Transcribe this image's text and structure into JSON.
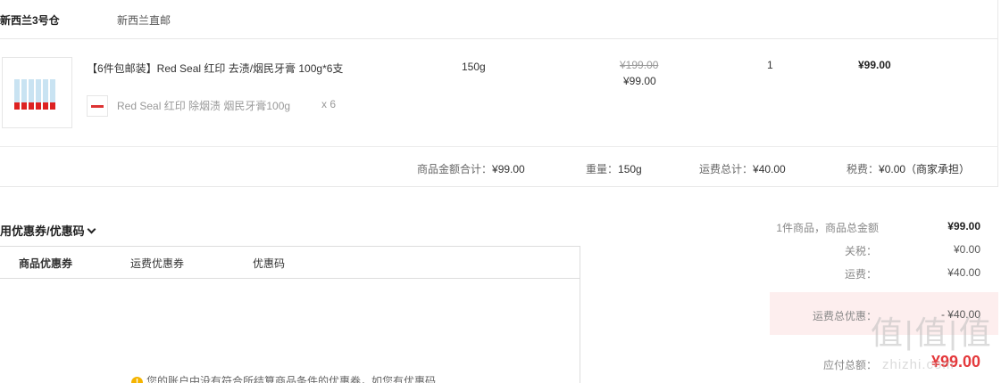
{
  "warehouse": {
    "name": "新西兰3号仓",
    "type": "新西兰直邮"
  },
  "product": {
    "title": "【6件包邮装】Red Seal 红印 去渍/烟民牙膏 100g*6支",
    "sub_item": {
      "name": "Red Seal 红印 除烟渍 烟民牙膏100g",
      "qty": "x 6"
    },
    "weight": "150g",
    "original_price": "¥199.00",
    "current_price": "¥99.00",
    "quantity": "1",
    "subtotal": "¥99.00"
  },
  "summary": {
    "goods_total_label": "商品金额合计：",
    "goods_total": "¥99.00",
    "weight_label": "重量：",
    "weight": "150g",
    "shipping_label": "运费总计：",
    "shipping": "¥40.00",
    "tax_label": "税费：",
    "tax": "¥0.00（商家承担）"
  },
  "coupon": {
    "toggle_label": "使用优惠券/优惠码",
    "tabs": [
      "商品优惠券",
      "运费优惠券",
      "优惠码"
    ],
    "notice": "您的账户中没有符合所结算商品条件的优惠券，如您有优惠码"
  },
  "totals": {
    "items_label": "1件商品，商品总金额",
    "items_value": "¥99.00",
    "tariff_label": "关税：",
    "tariff_value": "¥0.00",
    "shipping_label": "运费：",
    "shipping_value": "¥40.00",
    "shipping_discount_label": "运费总优惠：",
    "shipping_discount_value": "- ¥40.00",
    "payable_label": "应付总额：",
    "payable_value": "¥99.00"
  },
  "watermark": {
    "main": "值|值|值",
    "sub": "zhizhi.com"
  },
  "colors": {
    "accent_red": "#e4393c",
    "discount_bg": "#fdeeee",
    "border": "#e8e8e8"
  }
}
